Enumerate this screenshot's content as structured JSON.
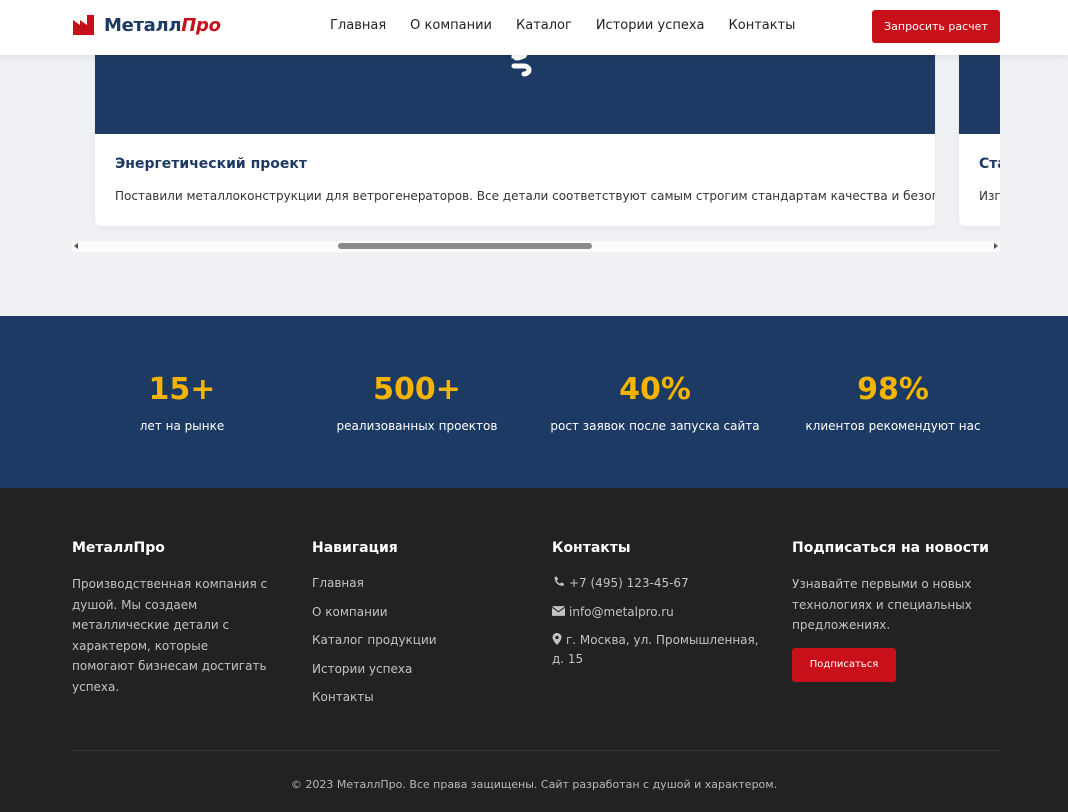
{
  "header": {
    "logo_main": "Металл",
    "logo_accent": "Про",
    "nav": [
      "Главная",
      "О компании",
      "Каталог",
      "Истории успеха",
      "Контакты"
    ],
    "cta_label": "Запросить расчет"
  },
  "carousel": {
    "cards": [
      {
        "title": "Энергетический проект",
        "description": "Поставили металлоконструкции для ветрогенераторов. Все детали соответствуют самым строгим стандартам качества и безопасности.",
        "icon": "wind-icon"
      },
      {
        "title": "Ста",
        "description": "Изго"
      }
    ]
  },
  "stats": [
    {
      "value": "15+",
      "label": "лет на рынке"
    },
    {
      "value": "500+",
      "label": "реализованных проектов"
    },
    {
      "value": "40%",
      "label": "рост заявок после запуска сайта"
    },
    {
      "value": "98%",
      "label": "клиентов рекомендуют нас"
    }
  ],
  "footer": {
    "about": {
      "title": "МеталлПро",
      "text": "Производственная компания с душой. Мы создаем металлические детали с характером, которые помогают бизнесам достигать успеха."
    },
    "navigation": {
      "title": "Навигация",
      "items": [
        "Главная",
        "О компании",
        "Каталог продукции",
        "Истории успеха",
        "Контакты"
      ]
    },
    "contacts": {
      "title": "Контакты",
      "phone": "+7 (495) 123-45-67",
      "email": "info@metalpro.ru",
      "address": "г. Москва, ул. Промышленная, д. 15"
    },
    "subscribe": {
      "title": "Подписаться на новости",
      "text": "Узнавайте первыми о новых технологиях и специальных предложениях.",
      "button": "Подписаться"
    },
    "copyright": "© 2023 МеталлПро. Все права защищены. Сайт разработан с душой и характером."
  },
  "colors": {
    "brand_navy": "#1c3a63",
    "brand_red": "#c8101b",
    "accent_yellow": "#f4b400",
    "footer_bg": "#222222"
  }
}
